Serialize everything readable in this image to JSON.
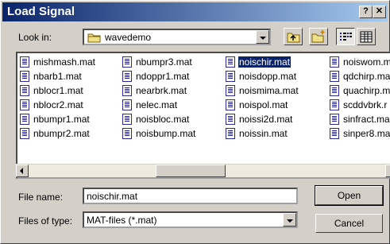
{
  "window": {
    "title": "Load Signal",
    "help_label": "?",
    "close_label": "✕"
  },
  "lookin": {
    "label": "Look in:",
    "folder": "wavedemo"
  },
  "toolbar": {
    "up_icon": "up-folder-icon",
    "new_folder_icon": "new-folder-icon",
    "list_icon": "list-view-icon",
    "details_icon": "details-view-icon"
  },
  "files": {
    "columns": [
      [
        "mishmash.mat",
        "nbarb1.mat",
        "nblocr1.mat",
        "nblocr2.mat",
        "nbumpr1.mat",
        "nbumpr2.mat"
      ],
      [
        "nbumpr3.mat",
        "ndoppr1.mat",
        "nearbrk.mat",
        "nelec.mat",
        "noisbloc.mat",
        "noisbump.mat"
      ],
      [
        "noischir.mat",
        "noisdopp.mat",
        "noismima.mat",
        "noispol.mat",
        "noissi2d.mat",
        "noissin.mat"
      ],
      [
        "noiswom.m",
        "qdchirp.ma",
        "quachirp.m",
        "scddvbrk.r",
        "sinfract.ma",
        "sinper8.ma"
      ]
    ],
    "selected": "noischir.mat"
  },
  "filename": {
    "label": "File name:",
    "value": "noischir.mat"
  },
  "filetype": {
    "label": "Files of type:",
    "value": "MAT-files (*.mat)"
  },
  "buttons": {
    "open": "Open",
    "cancel": "Cancel"
  }
}
